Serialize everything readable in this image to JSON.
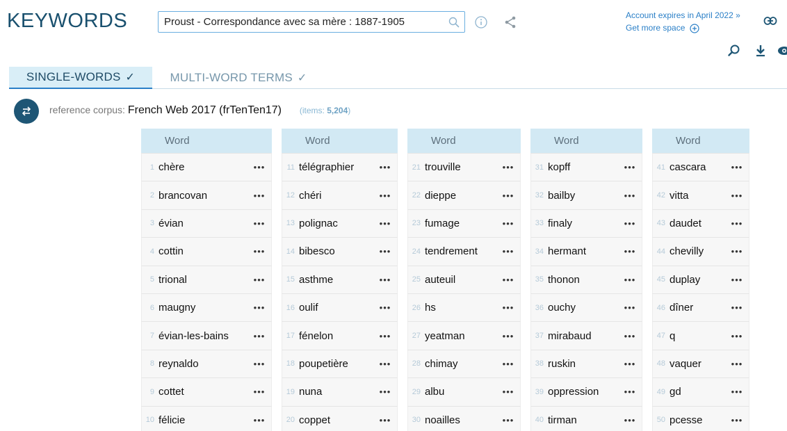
{
  "header": {
    "title": "KEYWORDS",
    "search_value": "Proust - Correspondance avec sa mère : 1887-1905",
    "account_expiry": "Account expires in April 2022 »",
    "more_space": "Get more space"
  },
  "tabs": [
    {
      "label": "SINGLE-WORDS",
      "check": "✓"
    },
    {
      "label": "MULTI-WORD TERMS",
      "check": "✓"
    }
  ],
  "corpus": {
    "label": "reference corpus:",
    "name": "French Web 2017 (frTenTen17)",
    "items_label": "(items:",
    "items_count": "5,204",
    "items_close": ")"
  },
  "columns": [
    {
      "header": "Word",
      "rows": [
        {
          "rank": "1",
          "word": "chère"
        },
        {
          "rank": "2",
          "word": "brancovan"
        },
        {
          "rank": "3",
          "word": "évian"
        },
        {
          "rank": "4",
          "word": "cottin"
        },
        {
          "rank": "5",
          "word": "trional"
        },
        {
          "rank": "6",
          "word": "maugny"
        },
        {
          "rank": "7",
          "word": "évian-les-bains"
        },
        {
          "rank": "8",
          "word": "reynaldo"
        },
        {
          "rank": "9",
          "word": "cottet"
        },
        {
          "rank": "10",
          "word": "félicie"
        }
      ]
    },
    {
      "header": "Word",
      "rows": [
        {
          "rank": "11",
          "word": "télégraphier"
        },
        {
          "rank": "12",
          "word": "chéri"
        },
        {
          "rank": "13",
          "word": "polignac"
        },
        {
          "rank": "14",
          "word": "bibesco"
        },
        {
          "rank": "15",
          "word": "asthme"
        },
        {
          "rank": "16",
          "word": "oulif"
        },
        {
          "rank": "17",
          "word": "fénelon"
        },
        {
          "rank": "18",
          "word": "poupetière"
        },
        {
          "rank": "19",
          "word": "nuna"
        },
        {
          "rank": "20",
          "word": "coppet"
        }
      ]
    },
    {
      "header": "Word",
      "rows": [
        {
          "rank": "21",
          "word": "trouville"
        },
        {
          "rank": "22",
          "word": "dieppe"
        },
        {
          "rank": "23",
          "word": "fumage"
        },
        {
          "rank": "24",
          "word": "tendrement"
        },
        {
          "rank": "25",
          "word": "auteuil"
        },
        {
          "rank": "26",
          "word": "hs"
        },
        {
          "rank": "27",
          "word": "yeatman"
        },
        {
          "rank": "28",
          "word": "chimay"
        },
        {
          "rank": "29",
          "word": "albu"
        },
        {
          "rank": "30",
          "word": "noailles"
        }
      ]
    },
    {
      "header": "Word",
      "rows": [
        {
          "rank": "31",
          "word": "kopff"
        },
        {
          "rank": "32",
          "word": "bailby"
        },
        {
          "rank": "33",
          "word": "finaly"
        },
        {
          "rank": "34",
          "word": "hermant"
        },
        {
          "rank": "35",
          "word": "thonon"
        },
        {
          "rank": "36",
          "word": "ouchy"
        },
        {
          "rank": "37",
          "word": "mirabaud"
        },
        {
          "rank": "38",
          "word": "ruskin"
        },
        {
          "rank": "39",
          "word": "oppression"
        },
        {
          "rank": "40",
          "word": "tirman"
        }
      ]
    },
    {
      "header": "Word",
      "rows": [
        {
          "rank": "41",
          "word": "cascara"
        },
        {
          "rank": "42",
          "word": "vitta"
        },
        {
          "rank": "43",
          "word": "daudet"
        },
        {
          "rank": "44",
          "word": "chevilly"
        },
        {
          "rank": "45",
          "word": "duplay"
        },
        {
          "rank": "46",
          "word": "dîner"
        },
        {
          "rank": "47",
          "word": "q"
        },
        {
          "rank": "48",
          "word": "vaquer"
        },
        {
          "rank": "49",
          "word": "gd"
        },
        {
          "rank": "50",
          "word": "pcesse"
        }
      ]
    }
  ],
  "row_menu": "•••",
  "icons": {
    "search": "search-icon",
    "info": "info-icon",
    "share": "share-icon",
    "plus": "plus-circle-icon",
    "link": "link-icon",
    "zoom": "zoom-icon",
    "download": "download-icon",
    "view": "eye-icon",
    "swap": "swap-icon"
  },
  "colors": {
    "brand": "#19506e",
    "accent": "#2a7fc7",
    "header_bg": "#d2e9f4",
    "tab_active_bg": "#d9eef7"
  }
}
